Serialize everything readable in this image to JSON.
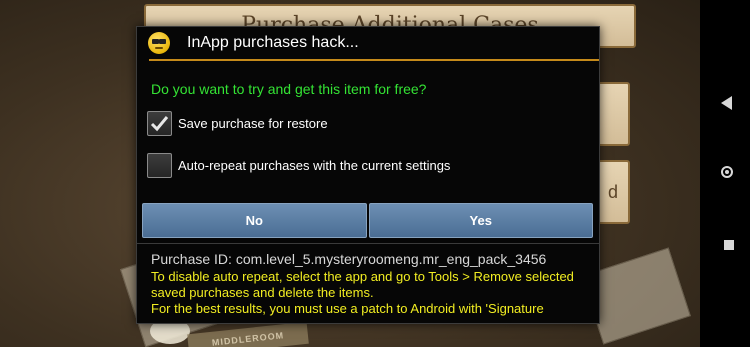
{
  "background_app": {
    "title": "Purchase Additional Cases",
    "side_glyph": "d",
    "badge_text": "MIDDLEROOM"
  },
  "dialog": {
    "title": "InApp purchases hack...",
    "icon": "sunglasses-emoji-icon",
    "question": "Do you want to try and get this item for free?",
    "options": [
      {
        "label": "Save purchase for restore",
        "checked": true
      },
      {
        "label": "Auto-repeat purchases with the current settings",
        "checked": false
      }
    ],
    "buttons": {
      "no": "No",
      "yes": "Yes"
    },
    "purchase_id": "Purchase ID: com.level_5.mysteryroomeng.mr_eng_pack_3456",
    "info_text": "To disable auto repeat, select the app and go to Tools > Remove selected saved purchases and delete the items.",
    "info_text_cut": "For the best results, you must use a patch to Android with 'Signature"
  },
  "colors": {
    "question": "#34e334",
    "info": "#f2ee22",
    "accent_line": "#c58a1a",
    "button": "#5a7da3"
  },
  "nav": {
    "back": "back-triangle-icon",
    "home": "home-circle-icon",
    "recents": "recents-square-icon"
  }
}
